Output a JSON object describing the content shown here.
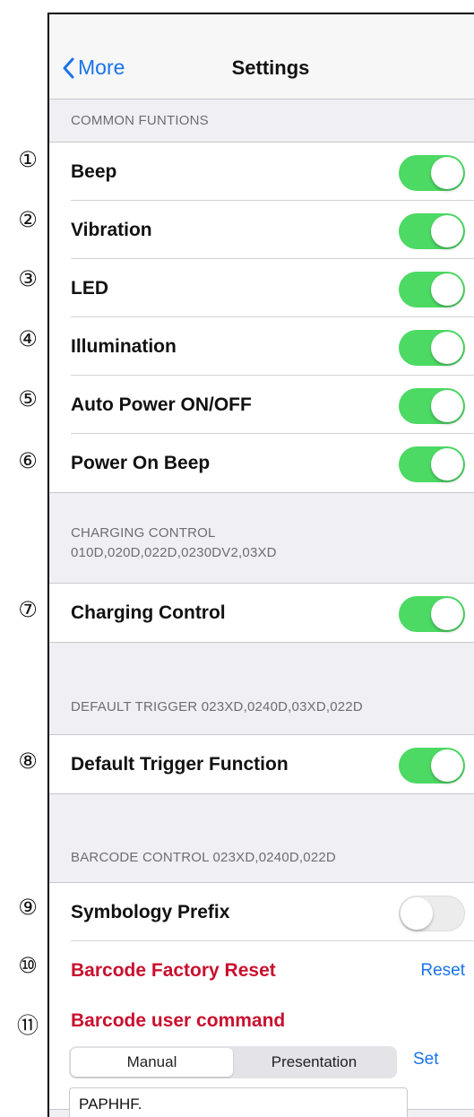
{
  "nav": {
    "back_label": "More",
    "title": "Settings"
  },
  "markers": [
    "①",
    "②",
    "③",
    "④",
    "⑤",
    "⑥",
    "⑦",
    "⑧",
    "⑨",
    "⑩",
    "⑪"
  ],
  "common": {
    "header": "COMMON FUNTIONS",
    "rows": [
      {
        "label": "Beep",
        "on": true
      },
      {
        "label": "Vibration",
        "on": true
      },
      {
        "label": "LED",
        "on": true
      },
      {
        "label": "Illumination",
        "on": true
      },
      {
        "label": "Auto Power ON/OFF",
        "on": true
      },
      {
        "label": "Power On Beep",
        "on": true
      }
    ]
  },
  "charging": {
    "header_line1": "CHARGING CONTROL",
    "header_line2": "010D,020D,022D,0230DV2,03XD",
    "label": "Charging Control",
    "on": true
  },
  "trigger": {
    "header": "DEFAULT TRIGGER 023XD,0240D,03XD,022D",
    "label": "Default Trigger Function",
    "on": true
  },
  "barcode": {
    "header": "BARCODE CONTROL  023XD,0240D,022D",
    "prefix_label": "Symbology Prefix",
    "prefix_on": false,
    "reset_label": "Barcode Factory Reset",
    "reset_button": "Reset",
    "command_label": "Barcode user command",
    "segments": [
      "Manual",
      "Presentation"
    ],
    "selected_segment": "Manual",
    "set_button": "Set",
    "command_value": "PAPHHF."
  },
  "colors": {
    "accent": "#1a73e8",
    "toggle_on": "#4cd964",
    "danger": "#c8102e",
    "grouped_bg": "#efeff4"
  }
}
